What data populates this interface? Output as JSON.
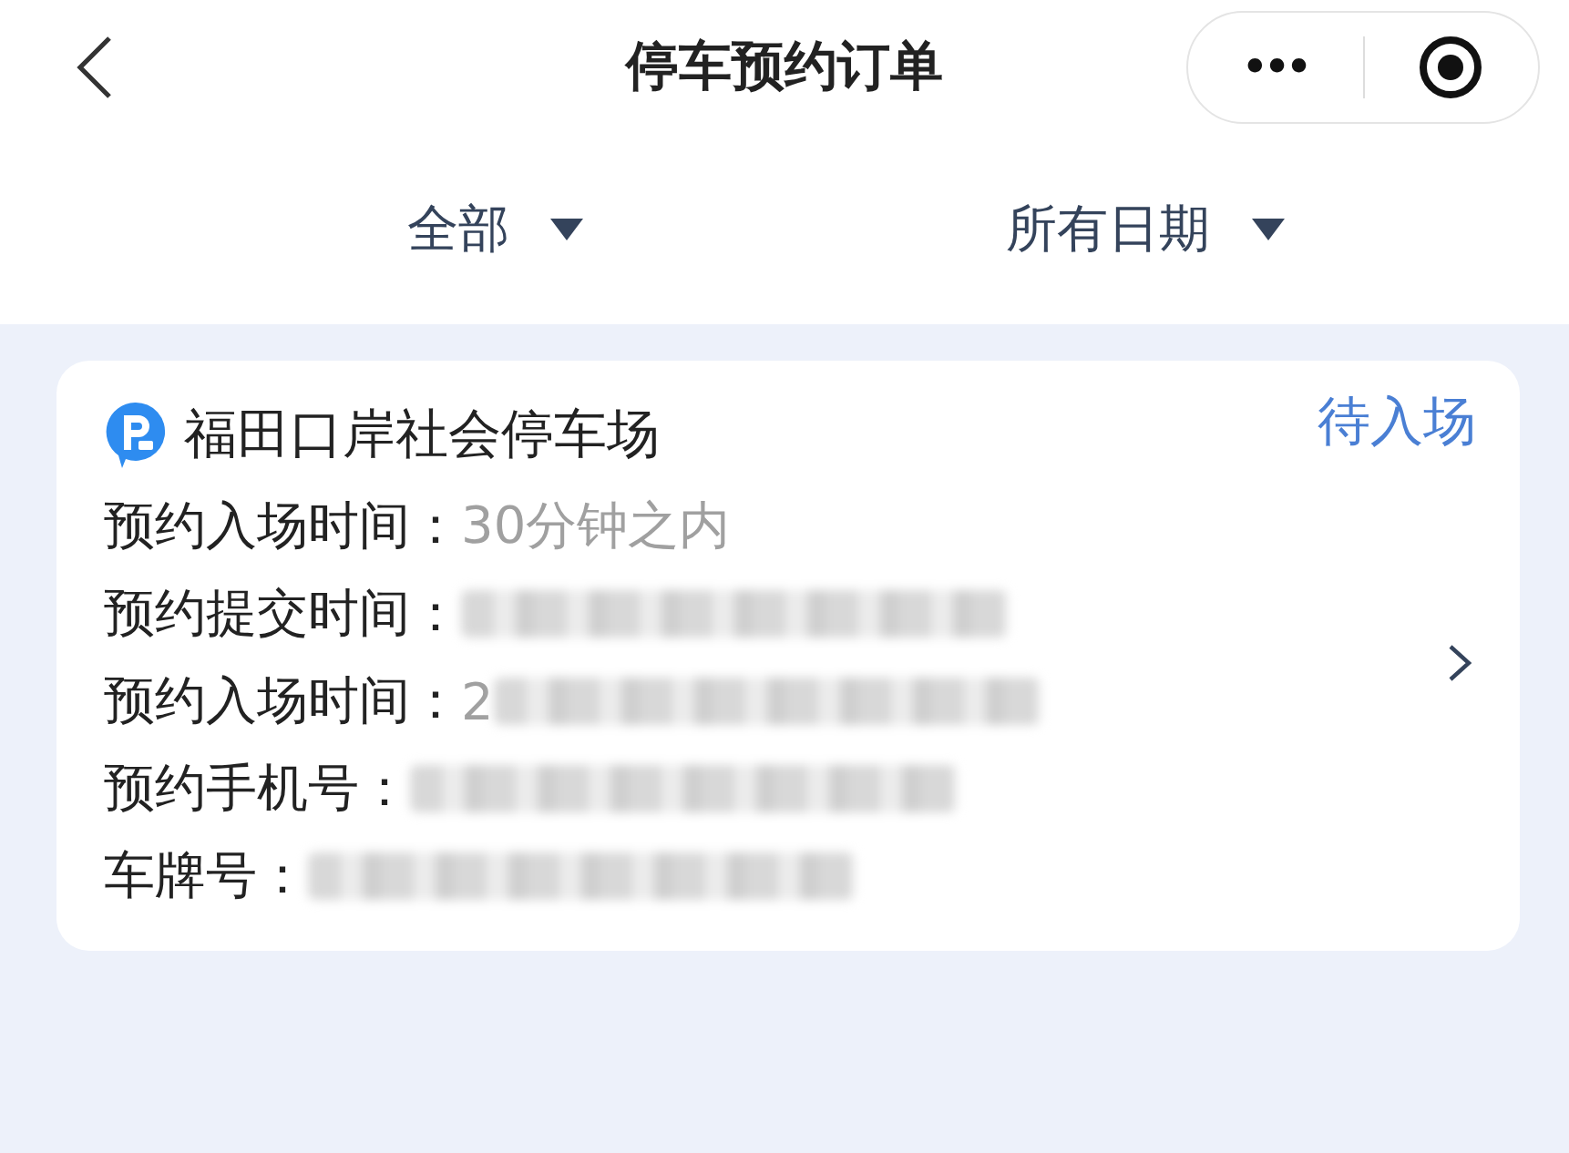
{
  "nav": {
    "title": "停车预约订单",
    "more": "•••"
  },
  "filters": [
    {
      "label": "全部"
    },
    {
      "label": "所有日期"
    }
  ],
  "order": {
    "name": "福田口岸社会停车场",
    "status": "待入场",
    "fields": [
      {
        "label": "预约入场时间：",
        "kind": "text",
        "value": "30分钟之内"
      },
      {
        "label": "预约提交时间：",
        "kind": "redacted"
      },
      {
        "label": "预约入场时间：",
        "kind": "redacted",
        "prefix": "2"
      },
      {
        "label": "预约手机号：",
        "kind": "redacted"
      },
      {
        "label": "车牌号：",
        "kind": "redacted"
      }
    ]
  }
}
